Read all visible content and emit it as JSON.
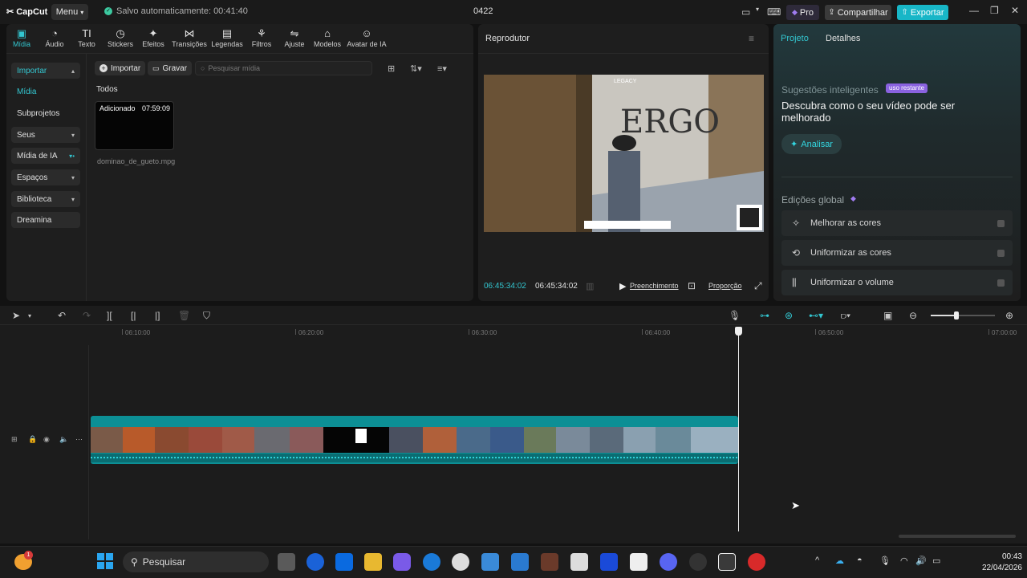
{
  "titlebar": {
    "app_name": "CapCut",
    "menu_label": "Menu",
    "autosave": "Salvo automaticamente: 00:41:40",
    "project_name": "0422",
    "pro_label": "Pro",
    "share_label": "Compartilhar",
    "export_label": "Exportar"
  },
  "media_tabs": [
    {
      "label": "Mídia",
      "icon": "media-icon",
      "active": true
    },
    {
      "label": "Áudio",
      "icon": "audio-icon"
    },
    {
      "label": "Texto",
      "icon": "text-icon"
    },
    {
      "label": "Stickers",
      "icon": "sticker-icon"
    },
    {
      "label": "Efeitos",
      "icon": "effects-icon"
    },
    {
      "label": "Transições",
      "icon": "transitions-icon"
    },
    {
      "label": "Legendas",
      "icon": "captions-icon"
    },
    {
      "label": "Filtros",
      "icon": "filters-icon"
    },
    {
      "label": "Ajuste",
      "icon": "adjust-icon"
    },
    {
      "label": "Modelos",
      "icon": "templates-icon"
    },
    {
      "label": "Avatar de IA",
      "icon": "ai-avatar-icon"
    }
  ],
  "sidebar": {
    "items": [
      {
        "label": "Importar",
        "style": "box-active",
        "chev": "up"
      },
      {
        "label": "Mídia",
        "style": "selected"
      },
      {
        "label": "Subprojetos",
        "style": "plain"
      },
      {
        "label": "Seus",
        "style": "box",
        "chev": "down"
      },
      {
        "label": "Mídia de IA",
        "style": "box",
        "chev": "down-dot"
      },
      {
        "label": "Espaços",
        "style": "box",
        "chev": "down"
      },
      {
        "label": "Biblioteca",
        "style": "box",
        "chev": "down"
      },
      {
        "label": "Dreamina",
        "style": "box"
      }
    ]
  },
  "media_panel": {
    "import_label": "Importar",
    "record_label": "Gravar",
    "search_placeholder": "Pesquisar mídia",
    "section_label": "Todos",
    "clip": {
      "badge": "Adicionado",
      "duration": "07:59:09",
      "filename": "dominao_de_gueto.mpg"
    }
  },
  "player": {
    "title": "Reprodutor",
    "current_time": "06:45:34:02",
    "total_time": "06:45:34:02",
    "fill_label": "Preenchimento",
    "ratio_label": "Proporção",
    "video_overlay_text": "LEGACY",
    "graffiti_text": "ERGO"
  },
  "right_panel": {
    "tab_project": "Projeto",
    "tab_details": "Detalhes",
    "suggest_title": "Sugestões inteligentes",
    "suggest_badge": "uso restante",
    "suggest_headline": "Descubra como o seu vídeo pode ser melhorado",
    "analyze_label": "Analisar",
    "global_title": "Edições global",
    "rows": [
      {
        "label": "Melhorar as cores",
        "icon": "enhance-color-icon"
      },
      {
        "label": "Uniformizar as cores",
        "icon": "match-color-icon"
      },
      {
        "label": "Uniformizar o volume",
        "icon": "volume-normalize-icon"
      }
    ]
  },
  "timeline": {
    "ruler": [
      "06:10:00",
      "06:20:00",
      "06:30:00",
      "06:40:00",
      "06:50:00",
      "07:00:00"
    ],
    "zoom_level": 0.4
  },
  "taskbar": {
    "search_label": "Pesquisar",
    "time": "00:43",
    "date": "22/04/2026",
    "notification_count": "1"
  },
  "colors": {
    "accent": "#33c6d0",
    "export": "#18b6c7",
    "track": "#0c8f95",
    "pro": "#a07cf0"
  }
}
